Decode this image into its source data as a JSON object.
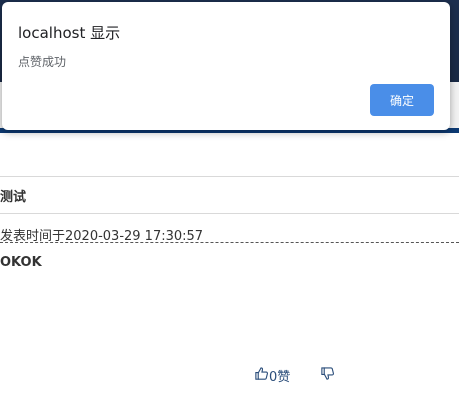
{
  "dialog": {
    "title": "localhost 显示",
    "message": "点赞成功",
    "ok_label": "确定"
  },
  "post": {
    "title": "测试",
    "meta": "发表时间于2020-03-29 17:30:57",
    "content": "OKOK"
  },
  "votes": {
    "like_count": "0赞",
    "like_icon": "thumbs-up-icon",
    "dislike_icon": "thumbs-down-icon"
  },
  "colors": {
    "header_bg": "#1c2f4f",
    "accent_button": "#4a8ee8",
    "vote_color": "#2a4d7a"
  }
}
